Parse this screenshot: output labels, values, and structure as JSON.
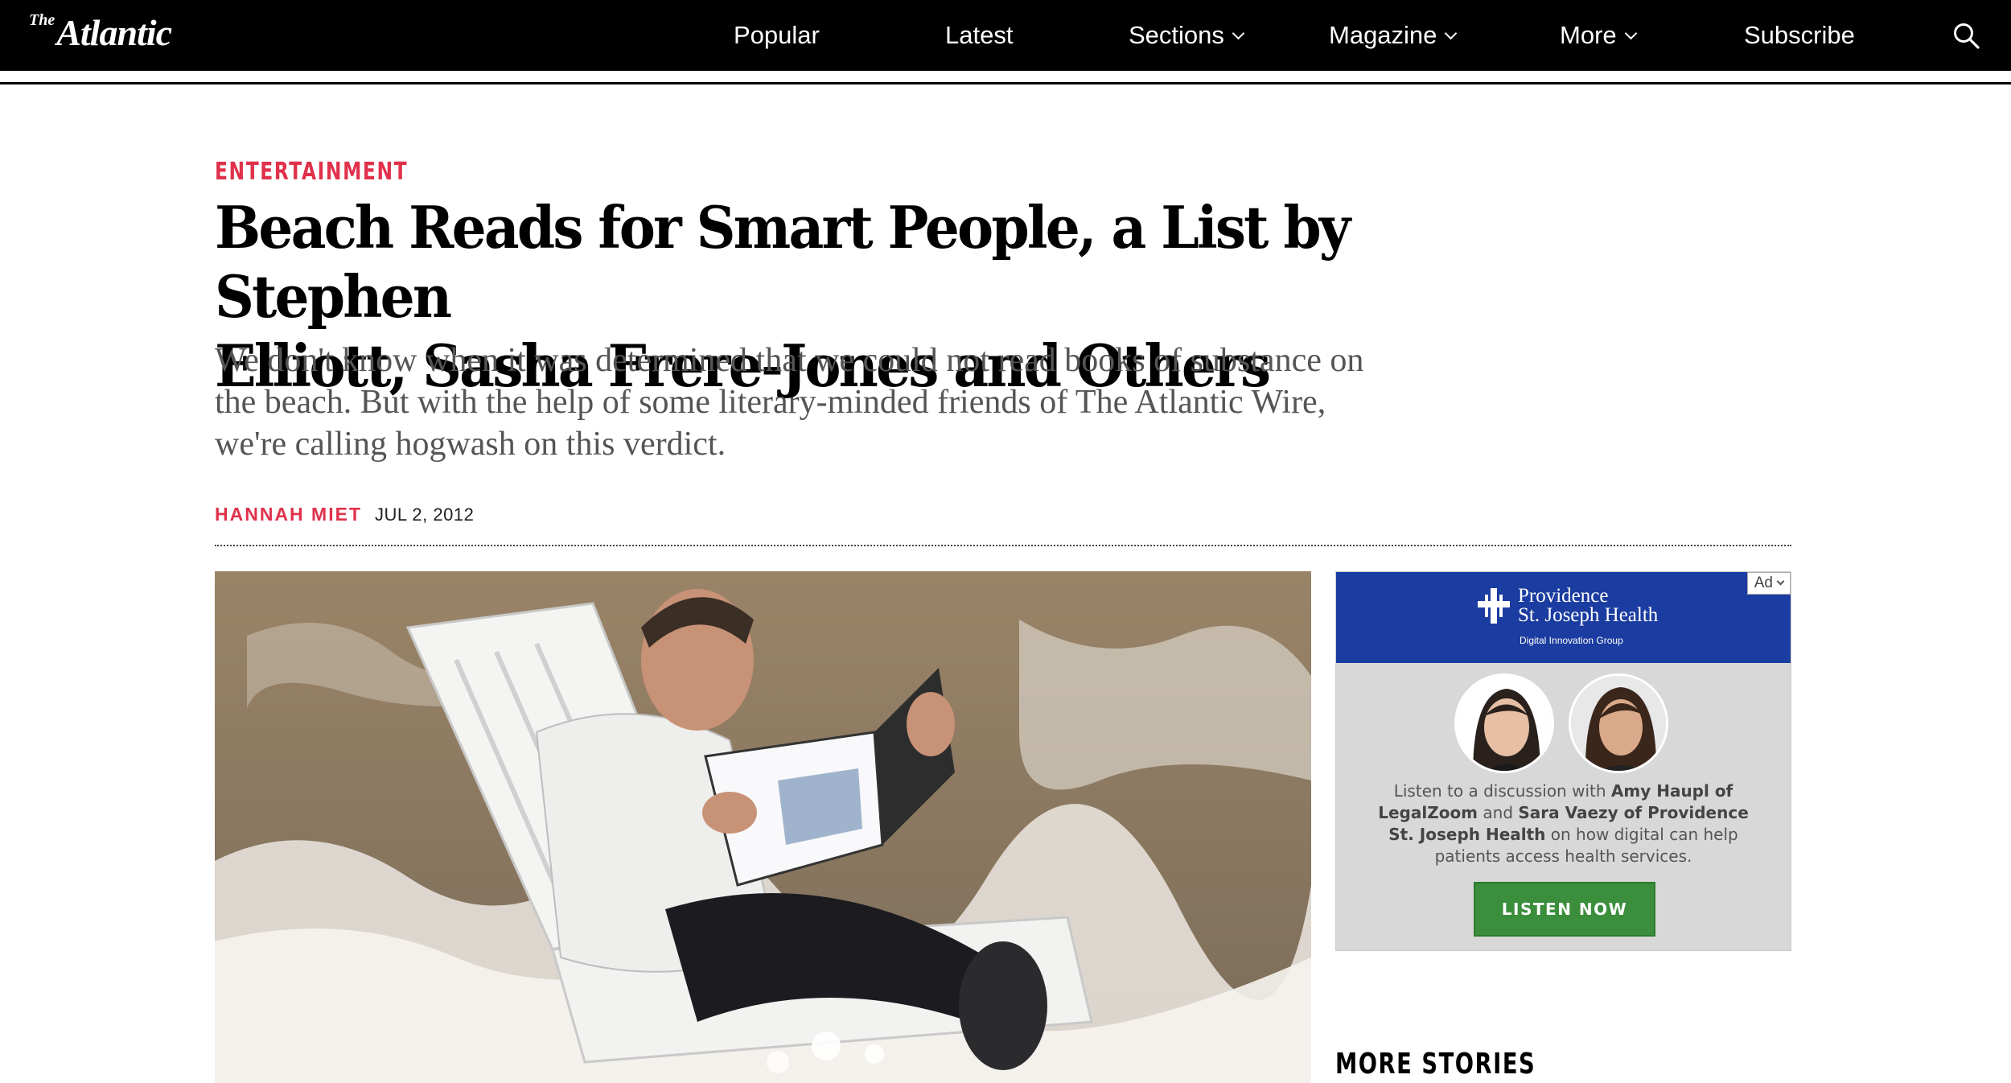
{
  "nav": {
    "logo_prefix": "The",
    "logo_text": "Atlantic",
    "items": [
      {
        "label": "Popular"
      },
      {
        "label": "Latest"
      },
      {
        "label": "Sections"
      },
      {
        "label": "Magazine"
      },
      {
        "label": "More"
      },
      {
        "label": "Subscribe"
      }
    ],
    "search_icon": "search-icon"
  },
  "article": {
    "section": "ENTERTAINMENT",
    "headline_line1": "Beach Reads for Smart People, a List by Stephen",
    "headline_line2": "Elliott, Sasha Frere-Jones and Others",
    "dek": "We don't know when it was determined that we could not read books of substance on the beach. But with the help of some literary-minded friends of The Atlantic Wire, we're calling hogwash on this verdict.",
    "author": "HANNAH MIET",
    "date": "JUL 2, 2012"
  },
  "ad": {
    "badge": "Ad",
    "brand_line1": "Providence",
    "brand_line2": "St. Joseph Health",
    "brand_sub": "Digital Innovation Group",
    "text_1": "Listen to a discussion with ",
    "text_bold_1": "Amy Haupl of LegalZoom",
    "text_2": " and ",
    "text_bold_2": "Sara Vaezy of Providence St. Joseph Health",
    "text_3": " on how digital can help patients access health services.",
    "button": "LISTEN NOW",
    "colors": {
      "header": "#1b3ca0",
      "button": "#3b8e3b"
    }
  },
  "sidebar": {
    "more_stories": "MORE STORIES"
  },
  "colors": {
    "accent": "#e0314b",
    "nav_bg": "#000000"
  }
}
